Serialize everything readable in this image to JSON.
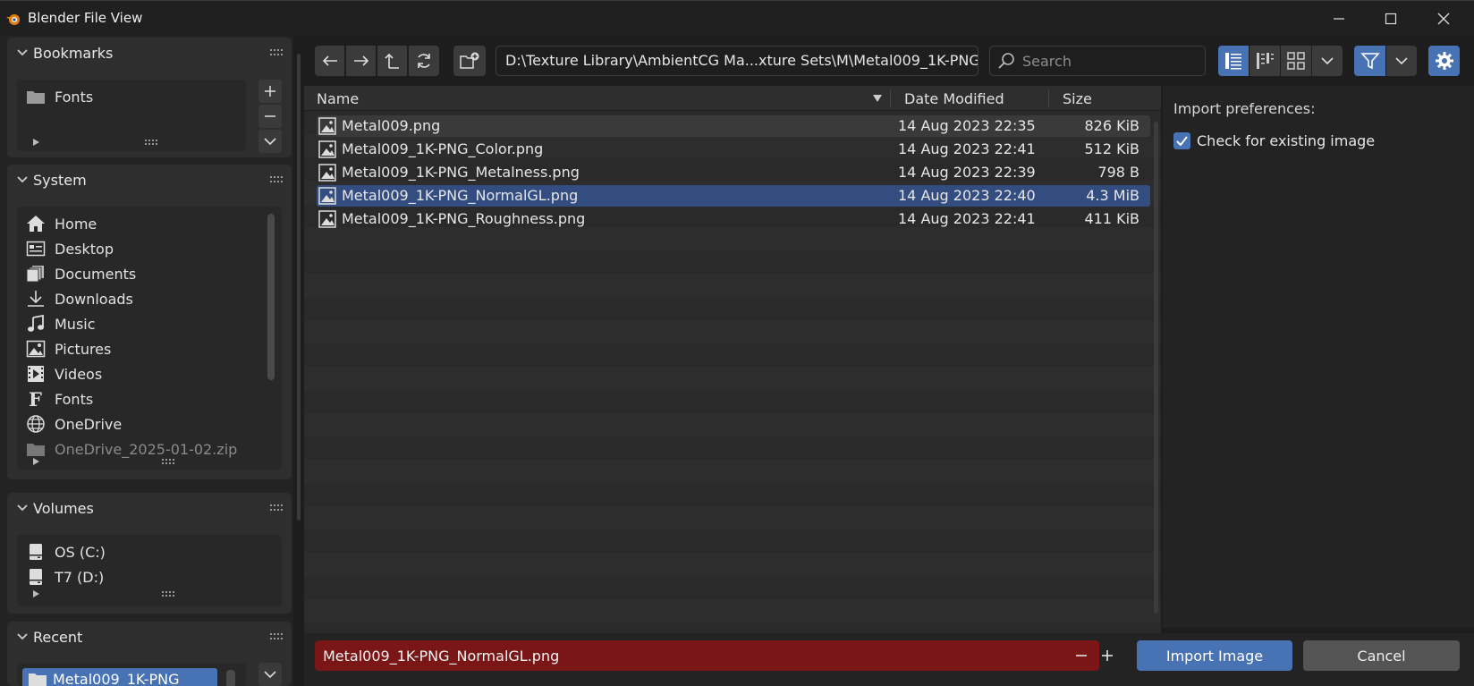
{
  "window": {
    "title": "Blender File View"
  },
  "sidebar": {
    "bookmarks": {
      "title": "Bookmarks",
      "items": [
        {
          "label": "Fonts",
          "icon": "folder-icon"
        }
      ]
    },
    "system": {
      "title": "System",
      "items": [
        {
          "label": "Home",
          "icon": "home-icon"
        },
        {
          "label": "Desktop",
          "icon": "desktop-icon"
        },
        {
          "label": "Documents",
          "icon": "documents-icon"
        },
        {
          "label": "Downloads",
          "icon": "download-icon"
        },
        {
          "label": "Music",
          "icon": "music-icon"
        },
        {
          "label": "Pictures",
          "icon": "picture-icon"
        },
        {
          "label": "Videos",
          "icon": "video-icon"
        },
        {
          "label": "Fonts",
          "icon": "font-icon"
        },
        {
          "label": "OneDrive",
          "icon": "globe-icon"
        },
        {
          "label": "OneDrive_2025-01-02.zip",
          "icon": "folder-icon"
        }
      ]
    },
    "volumes": {
      "title": "Volumes",
      "items": [
        {
          "label": "OS (C:)",
          "icon": "drive-icon"
        },
        {
          "label": "T7 (D:)",
          "icon": "drive-icon"
        }
      ]
    },
    "recent": {
      "title": "Recent",
      "items": [
        {
          "label": "Metal009_1K-PNG",
          "icon": "folder-icon"
        }
      ]
    }
  },
  "toolbar": {
    "path": "D:\\Texture Library\\AmbientCG Ma...xture Sets\\M\\Metal009_1K-PNG\\",
    "search_placeholder": "Search"
  },
  "columns": {
    "name": "Name",
    "date": "Date Modified",
    "size": "Size"
  },
  "files": [
    {
      "name": "Metal009.png",
      "date": "14 Aug 2023 22:35",
      "size": "826 KiB",
      "selected": false
    },
    {
      "name": "Metal009_1K-PNG_Color.png",
      "date": "14 Aug 2023 22:41",
      "size": "512 KiB",
      "selected": false
    },
    {
      "name": "Metal009_1K-PNG_Metalness.png",
      "date": "14 Aug 2023 22:39",
      "size": "798 B",
      "selected": false
    },
    {
      "name": "Metal009_1K-PNG_NormalGL.png",
      "date": "14 Aug 2023 22:40",
      "size": "4.3 MiB",
      "selected": true
    },
    {
      "name": "Metal009_1K-PNG_Roughness.png",
      "date": "14 Aug 2023 22:41",
      "size": "411 KiB",
      "selected": false
    }
  ],
  "prefs": {
    "title": "Import preferences:",
    "check_label": "Check for existing image",
    "checked": true
  },
  "bottom": {
    "filename": "Metal009_1K-PNG_NormalGL.png",
    "import_label": "Import Image",
    "cancel_label": "Cancel"
  },
  "colors": {
    "accent": "#4772b3",
    "selected_row": "#334d80",
    "filename_bg": "#7a1616",
    "panel": "#2e2e2e"
  }
}
